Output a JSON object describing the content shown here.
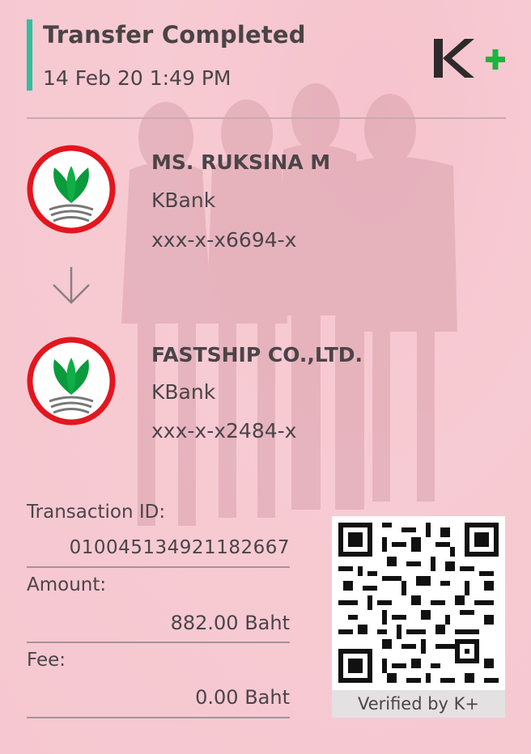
{
  "header": {
    "title": "Transfer Completed",
    "datetime": "14 Feb 20  1:49 PM",
    "logo_text": "K+"
  },
  "sender": {
    "name": "MS. RUKSINA M",
    "bank": "KBank",
    "account": "xxx-x-x6694-x"
  },
  "receiver": {
    "name": "FASTSHIP CO.,LTD.",
    "bank": "KBank",
    "account": "xxx-x-x2484-x"
  },
  "details": {
    "transaction_label": "Transaction ID:",
    "transaction_value": "010045134921182667",
    "amount_label": "Amount:",
    "amount_value": "882.00 Baht",
    "fee_label": "Fee:",
    "fee_value": "0.00 Baht"
  },
  "qr": {
    "caption": "Verified by K+"
  },
  "colors": {
    "accent": "#2fbfa0",
    "kbank_green": "#0b9a3c",
    "kbank_ring_red": "#e3161e",
    "logo_dark": "#2e2a2b",
    "logo_plus": "#18b53f"
  },
  "icons": [
    "kbank-logo-icon",
    "arrow-down-icon",
    "kplus-logo-icon",
    "qr-code-icon"
  ]
}
